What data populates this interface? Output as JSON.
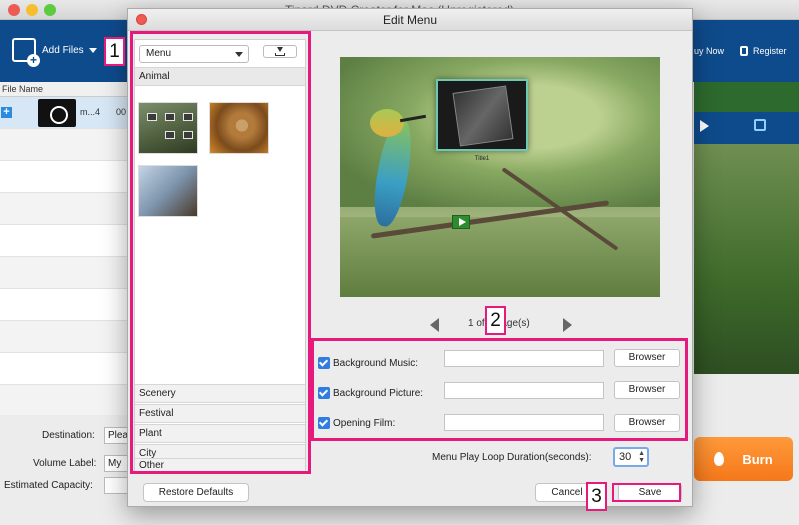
{
  "app": {
    "title": "Tipard DVD Creator for Mac (Unregistered)",
    "add_files": "Add Files",
    "buy_now": "uy Now",
    "register": "Register",
    "list_header": "File Name",
    "file_name": "m...4",
    "file_duration": "00",
    "destination_label": "Destination:",
    "destination_value": "Plea",
    "volume_label": "Volume Label:",
    "volume_value": "My",
    "capacity_label": "Estimated Capacity:",
    "burn_label": "Burn"
  },
  "dialog": {
    "title": "Edit Menu",
    "menu_select": "Menu",
    "categories": [
      "Animal",
      "Scenery",
      "Festival",
      "Plant",
      "City",
      "Other"
    ],
    "preview_title_text": "Title1",
    "page_indicator": "1 of 1 page(s)",
    "options": [
      {
        "label": "Background Music:",
        "value": "",
        "checked": true,
        "button": "Browser"
      },
      {
        "label": "Background Picture:",
        "value": "",
        "checked": true,
        "button": "Browser"
      },
      {
        "label": "Opening Film:",
        "value": "",
        "checked": true,
        "button": "Browser"
      }
    ],
    "loop_label": "Menu Play Loop Duration(seconds):",
    "loop_value": "30",
    "restore_defaults": "Restore Defaults",
    "cancel": "Cancel",
    "save": "Save"
  },
  "annotations": {
    "step1": "1",
    "step2": "2",
    "step3": "3",
    "color": "#e6197c"
  }
}
